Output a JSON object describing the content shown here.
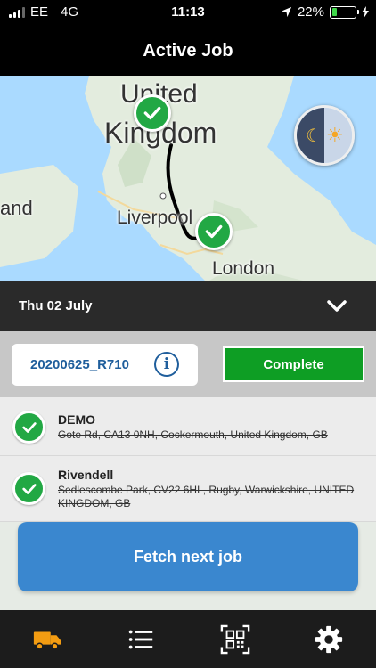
{
  "status_bar": {
    "carrier": "EE",
    "network": "4G",
    "time": "11:13",
    "battery": "22%",
    "battery_level": 0.22
  },
  "header": {
    "title": "Active Job"
  },
  "map": {
    "labels": {
      "united": "United",
      "kingdom": "Kingdom",
      "ireland": "and",
      "liverpool": "Liverpool",
      "london": "London"
    }
  },
  "date_bar": {
    "date": "Thu 02 July"
  },
  "job": {
    "id": "20200625_R710",
    "complete_label": "Complete"
  },
  "stops": [
    {
      "name": "DEMO",
      "address": "Gote Rd, CA13 0NH, Cockermouth, United Kingdom, GB"
    },
    {
      "name": "Rivendell",
      "address": "Sedlescombe Park, CV22 6HL, Rugby, Warwickshire, UNITED KINGDOM, GB"
    }
  ],
  "fetch_label": "Fetch next job",
  "tabs": [
    "truck-icon",
    "list-icon",
    "qr-code-icon",
    "gear-icon"
  ],
  "colors": {
    "accent_orange": "#f39c12",
    "complete_green": "#0e9e24",
    "fetch_blue": "#3a87cf",
    "check_green": "#22a844"
  }
}
